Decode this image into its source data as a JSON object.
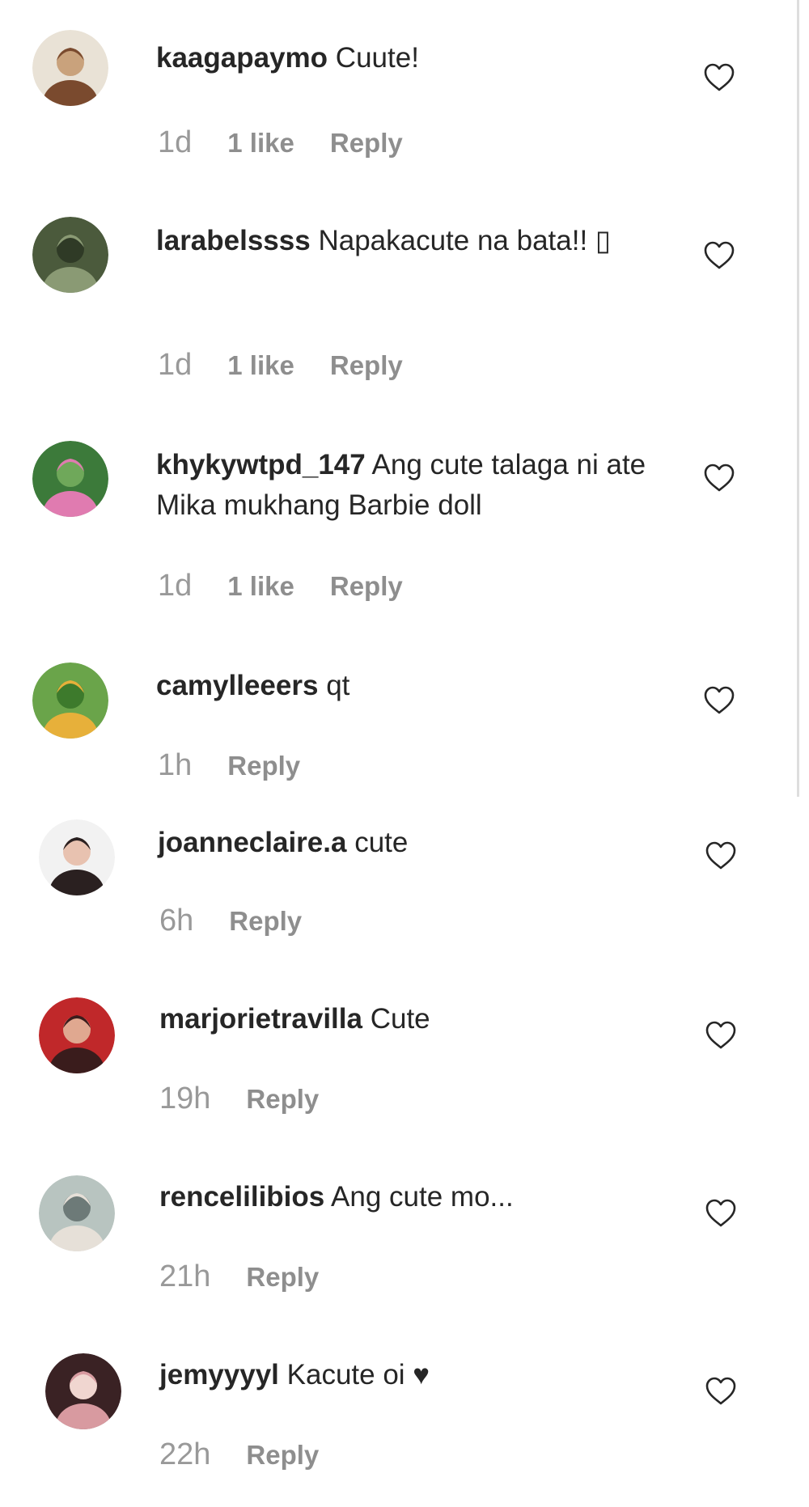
{
  "comments": [
    {
      "username": "kaagapaymo",
      "text": "Cuute!",
      "time": "1d",
      "likes": "1 like",
      "reply_label": "Reply",
      "like_icon": "heart-outline-icon",
      "avatar_colors": [
        "#e9e2d6",
        "#7a4a2e",
        "#c9a27c"
      ]
    },
    {
      "username": "larabelssss",
      "text": "Napakacute na bata!! ▯",
      "time": "1d",
      "likes": "1 like",
      "reply_label": "Reply",
      "like_icon": "heart-outline-icon",
      "avatar_colors": [
        "#4b5a3c",
        "#8a9a74",
        "#2f3a26"
      ]
    },
    {
      "username": "khykywtpd_147",
      "text": "Ang cute talaga ni ate Mika mukhang Barbie doll",
      "time": "1d",
      "likes": "1 like",
      "reply_label": "Reply",
      "like_icon": "heart-outline-icon",
      "avatar_colors": [
        "#3c7a3a",
        "#e07bb0",
        "#6fa85a"
      ]
    },
    {
      "username": "camylleeers",
      "text": "qt",
      "time": "1h",
      "likes": "",
      "reply_label": "Reply",
      "like_icon": "heart-outline-icon",
      "avatar_colors": [
        "#6aa44a",
        "#e7b03a",
        "#3d7a2c"
      ]
    },
    {
      "username": "joanneclaire.a",
      "text": "cute",
      "time": "6h",
      "likes": "",
      "reply_label": "Reply",
      "like_icon": "heart-outline-icon",
      "avatar_colors": [
        "#f2f2f2",
        "#2a2020",
        "#e8c2b0"
      ]
    },
    {
      "username": "marjorietravilla",
      "text": "Cute",
      "time": "19h",
      "likes": "",
      "reply_label": "Reply",
      "like_icon": "heart-outline-icon",
      "avatar_colors": [
        "#c0282a",
        "#3a1c1c",
        "#e0a890"
      ]
    },
    {
      "username": "rencelilibios",
      "text": "Ang cute mo...",
      "time": "21h",
      "likes": "",
      "reply_label": "Reply",
      "like_icon": "heart-outline-icon",
      "avatar_colors": [
        "#b8c4c0",
        "#e6e0d8",
        "#6d7a78"
      ]
    },
    {
      "username": "jemyyyyl",
      "text": "Kacute oi ♥",
      "time": "22h",
      "likes": "",
      "reply_label": "Reply",
      "like_icon": "heart-outline-icon",
      "avatar_colors": [
        "#3a2224",
        "#d89aa0",
        "#f0d6d0"
      ]
    }
  ]
}
